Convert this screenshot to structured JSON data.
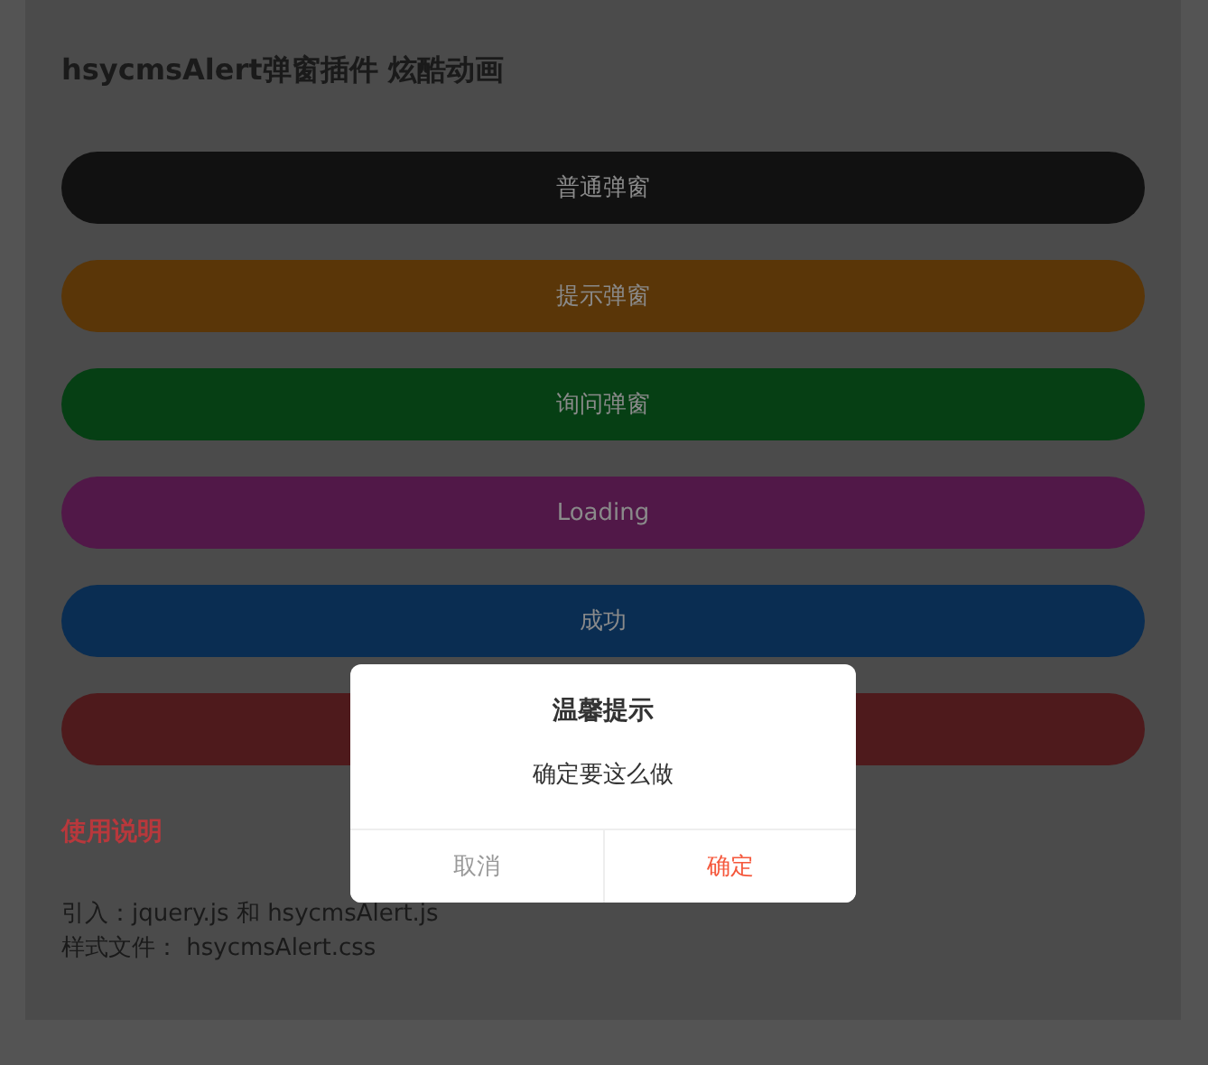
{
  "title": "hsycmsAlert弹窗插件 炫酷动画",
  "buttons": [
    {
      "label": "普通弹窗",
      "color": "#111111"
    },
    {
      "label": "提示弹窗",
      "color": "#5a3608"
    },
    {
      "label": "询问弹窗",
      "color": "#063f14"
    },
    {
      "label": "Loading",
      "color": "#511848"
    },
    {
      "label": "成功",
      "color": "#0a2d52"
    },
    {
      "color": "#4e1a1c"
    }
  ],
  "usage": {
    "heading": "使用说明",
    "lines": [
      "引入：jquery.js 和 hsycmsAlert.js",
      "样式文件：  hsycmsAlert.css"
    ]
  },
  "dialog": {
    "title": "温馨提示",
    "message": "确定要这么做",
    "actions": [
      {
        "label": "取消",
        "kind": "cancel"
      },
      {
        "label": "确定",
        "kind": "confirm"
      }
    ]
  }
}
